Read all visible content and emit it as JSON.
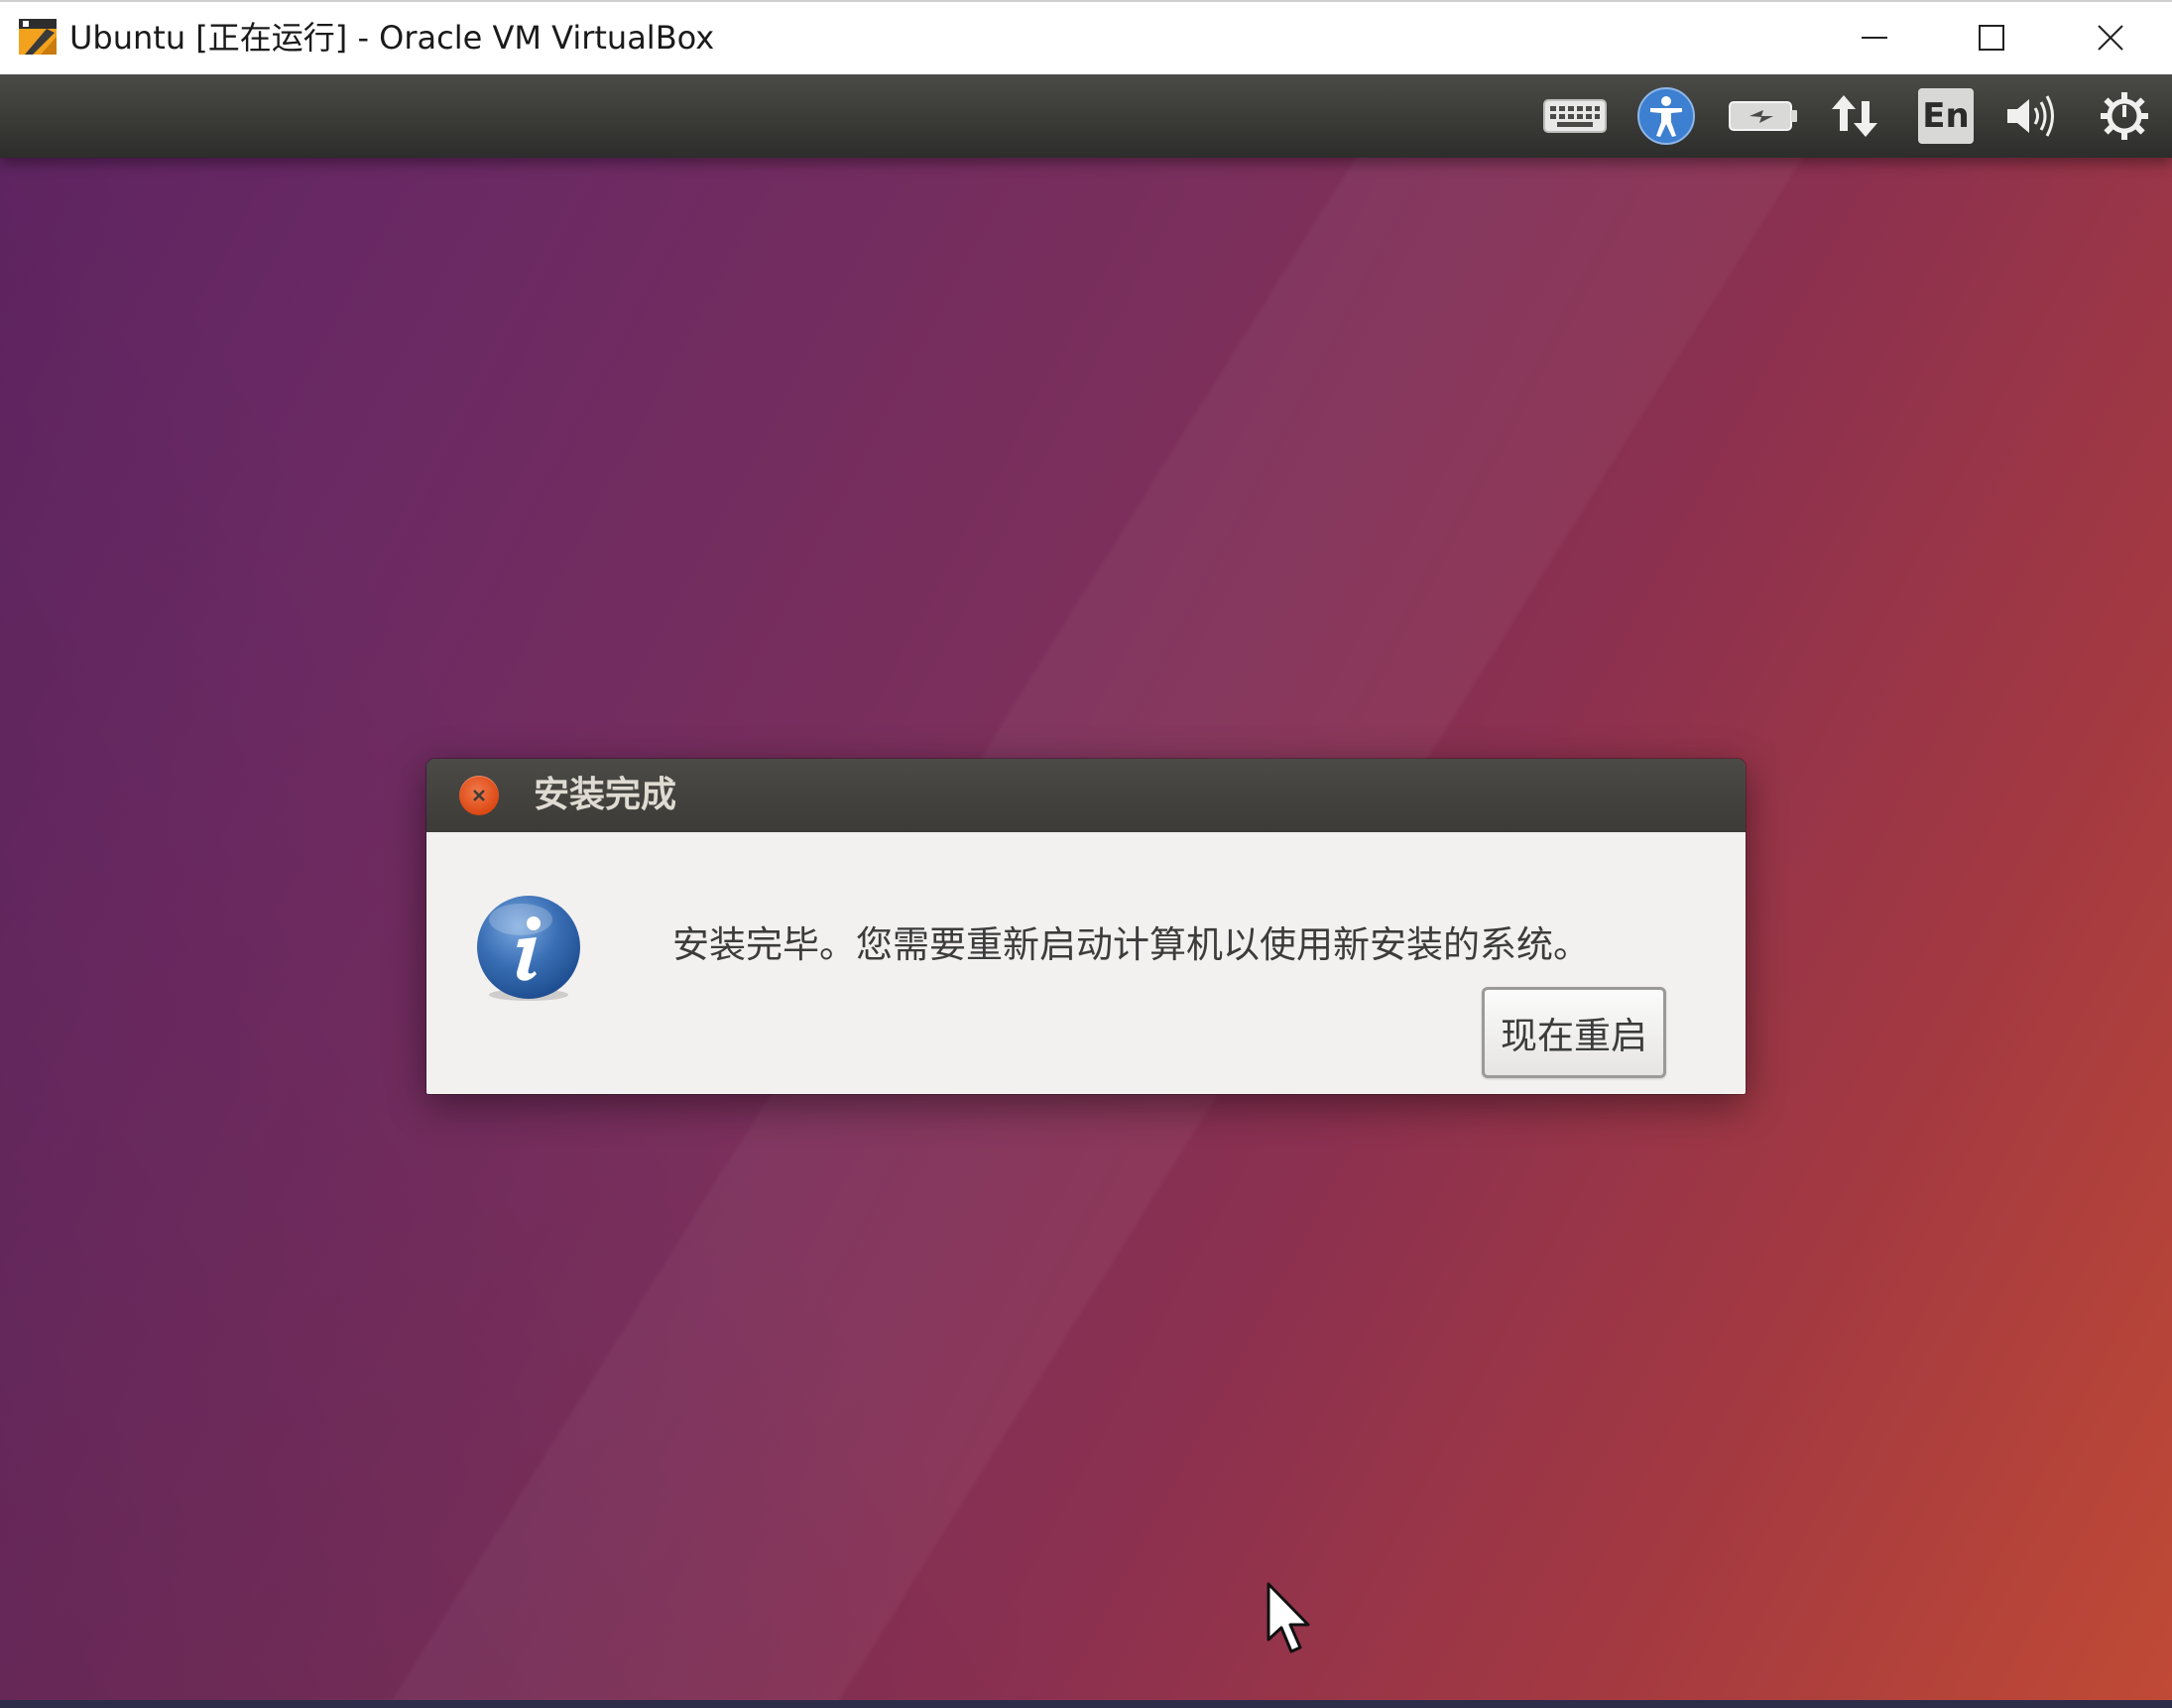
{
  "window": {
    "title": "Ubuntu [正在运行] - Oracle VM VirtualBox",
    "icon": "virtualbox-icon",
    "controls": [
      "minimize-icon",
      "maximize-icon",
      "close-icon"
    ]
  },
  "panel": {
    "indicators": [
      "keyboard-icon",
      "accessibility-icon",
      "battery-icon",
      "network-arrows-icon",
      "language-indicator",
      "volume-icon",
      "power-gear-icon"
    ],
    "language_label": "En"
  },
  "dialog": {
    "title": "安装完成",
    "message": "安装完毕。您需要重新启动计算机以使用新安装的系统。",
    "restart_button": "现在重启",
    "icon": "info-icon",
    "close_icon": "close-icon"
  },
  "colors": {
    "ubuntu_orange": "#dd4814",
    "panel_dark": "#3c3b37",
    "dialog_bg": "#f2f1f0",
    "info_blue": "#3a6fb5"
  }
}
